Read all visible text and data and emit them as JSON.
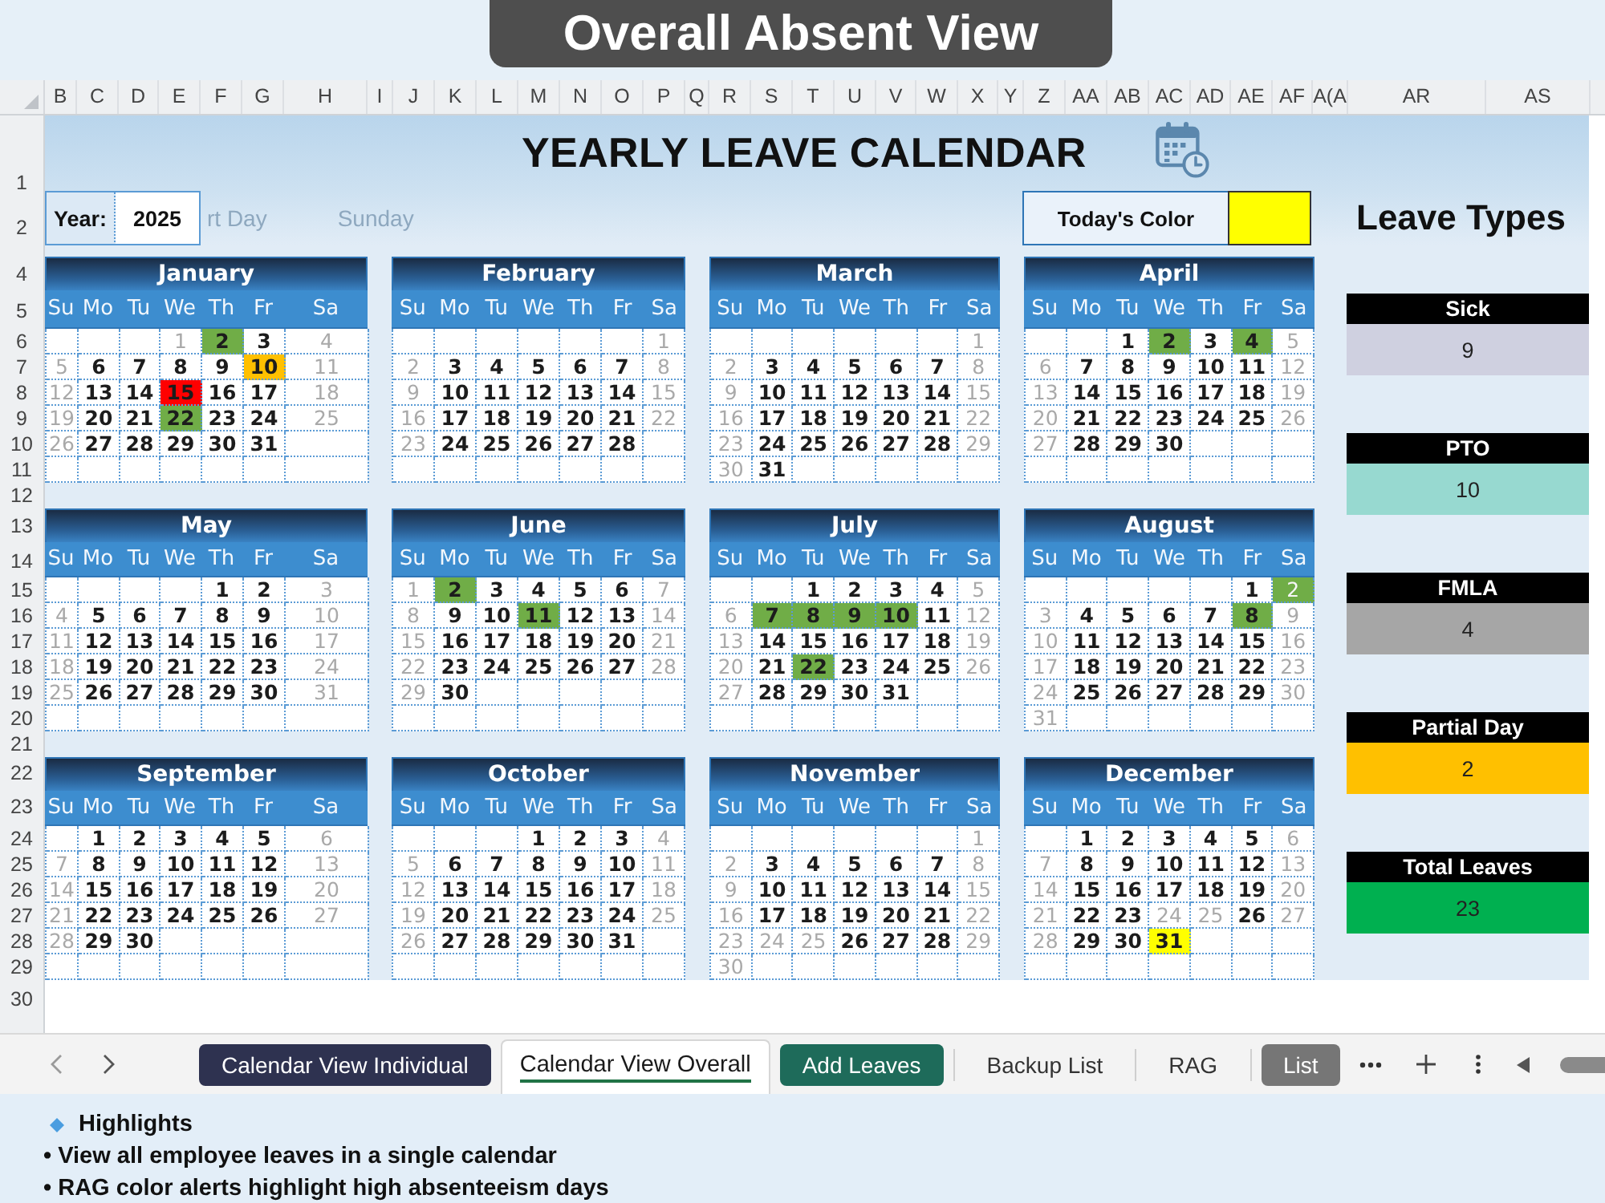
{
  "banner": "Overall Absent View",
  "column_headers": [
    "B",
    "C",
    "D",
    "E",
    "F",
    "G",
    "H",
    "I",
    "J",
    "K",
    "L",
    "M",
    "N",
    "O",
    "P",
    "Q",
    "R",
    "S",
    "T",
    "U",
    "V",
    "W",
    "X",
    "Y",
    "Z",
    "AA",
    "AB",
    "AC",
    "AD",
    "AE",
    "AF",
    "A(A",
    "AR",
    "AS"
  ],
  "row_headers": [
    "1",
    "2",
    "4",
    "5",
    "6",
    "7",
    "8",
    "9",
    "10",
    "11",
    "12",
    "13",
    "14",
    "15",
    "16",
    "17",
    "18",
    "19",
    "20",
    "21",
    "22",
    "23",
    "24",
    "25",
    "26",
    "27",
    "28",
    "29",
    "30"
  ],
  "title": "YEARLY LEAVE CALENDAR",
  "year": {
    "label": "Year:",
    "value": "2025"
  },
  "faint_labels": [
    "rt Day",
    "Sunday"
  ],
  "today": {
    "label": "Today's Color",
    "color": "#ffff00"
  },
  "months": [
    {
      "name": "January",
      "weekdays": [
        "Su",
        "Mo",
        "Tu",
        "We",
        "Th",
        "Fr",
        "Sa"
      ],
      "weeks": [
        [
          {
            "day": "1",
            "off": true
          },
          {
            "day": "2",
            "off": false,
            "color": "#70ad47"
          },
          {
            "day": "3",
            "off": false
          },
          {
            "day": "4",
            "off": true
          }
        ],
        [
          {
            "day": "5",
            "off": true
          },
          {
            "day": "6",
            "off": false
          },
          {
            "day": "7",
            "off": false
          },
          {
            "day": "8",
            "off": false
          },
          {
            "day": "9",
            "off": false
          },
          {
            "day": "10",
            "off": false,
            "color": "#ffc000"
          },
          {
            "day": "11",
            "off": true
          }
        ],
        [
          {
            "day": "12",
            "off": true
          },
          {
            "day": "13",
            "off": false
          },
          {
            "day": "14",
            "off": false
          },
          {
            "day": "15",
            "off": false,
            "color": "#ff0000"
          },
          {
            "day": "16",
            "off": false
          },
          {
            "day": "17",
            "off": false
          },
          {
            "day": "18",
            "off": true
          }
        ],
        [
          {
            "day": "19",
            "off": true
          },
          {
            "day": "20",
            "off": false
          },
          {
            "day": "21",
            "off": false
          },
          {
            "day": "22",
            "off": false,
            "color": "#70ad47"
          },
          {
            "day": "23",
            "off": false
          },
          {
            "day": "24",
            "off": false
          },
          {
            "day": "25",
            "off": true
          }
        ],
        [
          {
            "day": "26",
            "off": true
          },
          {
            "day": "27",
            "off": false
          },
          {
            "day": "28",
            "off": false
          },
          {
            "day": "29",
            "off": false
          },
          {
            "day": "30",
            "off": false
          },
          {
            "day": "31",
            "off": false
          }
        ]
      ]
    },
    {
      "name": "February",
      "weekdays": [
        "Su",
        "Mo",
        "Tu",
        "We",
        "Th",
        "Fr",
        "Sa"
      ],
      "weeks": [
        [
          {
            "day": "1",
            "off": true
          }
        ],
        [
          {
            "day": "2",
            "off": true
          },
          {
            "day": "3",
            "off": false
          },
          {
            "day": "4",
            "off": false
          },
          {
            "day": "5",
            "off": false
          },
          {
            "day": "6",
            "off": false
          },
          {
            "day": "7",
            "off": false
          },
          {
            "day": "8",
            "off": true
          }
        ],
        [
          {
            "day": "9",
            "off": true
          },
          {
            "day": "10",
            "off": false
          },
          {
            "day": "11",
            "off": false
          },
          {
            "day": "12",
            "off": false
          },
          {
            "day": "13",
            "off": false
          },
          {
            "day": "14",
            "off": false
          },
          {
            "day": "15",
            "off": true
          }
        ],
        [
          {
            "day": "16",
            "off": true
          },
          {
            "day": "17",
            "off": false
          },
          {
            "day": "18",
            "off": false
          },
          {
            "day": "19",
            "off": false
          },
          {
            "day": "20",
            "off": false
          },
          {
            "day": "21",
            "off": false
          },
          {
            "day": "22",
            "off": true
          }
        ],
        [
          {
            "day": "23",
            "off": true
          },
          {
            "day": "24",
            "off": false
          },
          {
            "day": "25",
            "off": false
          },
          {
            "day": "26",
            "off": false
          },
          {
            "day": "27",
            "off": false
          },
          {
            "day": "28",
            "off": false
          }
        ]
      ]
    },
    {
      "name": "March",
      "weekdays": [
        "Su",
        "Mo",
        "Tu",
        "We",
        "Th",
        "Fr",
        "Sa"
      ],
      "weeks": [
        [
          {
            "day": "1",
            "off": true
          }
        ],
        [
          {
            "day": "2",
            "off": true
          },
          {
            "day": "3",
            "off": false
          },
          {
            "day": "4",
            "off": false
          },
          {
            "day": "5",
            "off": false
          },
          {
            "day": "6",
            "off": false
          },
          {
            "day": "7",
            "off": false
          },
          {
            "day": "8",
            "off": true
          }
        ],
        [
          {
            "day": "9",
            "off": true
          },
          {
            "day": "10",
            "off": false
          },
          {
            "day": "11",
            "off": false
          },
          {
            "day": "12",
            "off": false
          },
          {
            "day": "13",
            "off": false
          },
          {
            "day": "14",
            "off": false
          },
          {
            "day": "15",
            "off": true
          }
        ],
        [
          {
            "day": "16",
            "off": true
          },
          {
            "day": "17",
            "off": false
          },
          {
            "day": "18",
            "off": false
          },
          {
            "day": "19",
            "off": false
          },
          {
            "day": "20",
            "off": false
          },
          {
            "day": "21",
            "off": false
          },
          {
            "day": "22",
            "off": true
          }
        ],
        [
          {
            "day": "23",
            "off": true
          },
          {
            "day": "24",
            "off": false
          },
          {
            "day": "25",
            "off": false
          },
          {
            "day": "26",
            "off": false
          },
          {
            "day": "27",
            "off": false
          },
          {
            "day": "28",
            "off": false
          },
          {
            "day": "29",
            "off": true
          }
        ],
        [
          {
            "day": "30",
            "off": true
          },
          {
            "day": "31",
            "off": false
          }
        ]
      ]
    },
    {
      "name": "April",
      "weekdays": [
        "Su",
        "Mo",
        "Tu",
        "We",
        "Th",
        "Fr",
        "Sa"
      ],
      "weeks": [
        [
          {
            "day": "1",
            "off": false
          },
          {
            "day": "2",
            "off": false,
            "color": "#70ad47"
          },
          {
            "day": "3",
            "off": false
          },
          {
            "day": "4",
            "off": false,
            "color": "#70ad47"
          },
          {
            "day": "5",
            "off": true
          }
        ],
        [
          {
            "day": "6",
            "off": true
          },
          {
            "day": "7",
            "off": false
          },
          {
            "day": "8",
            "off": false
          },
          {
            "day": "9",
            "off": false
          },
          {
            "day": "10",
            "off": false
          },
          {
            "day": "11",
            "off": false
          },
          {
            "day": "12",
            "off": true
          }
        ],
        [
          {
            "day": "13",
            "off": true
          },
          {
            "day": "14",
            "off": false
          },
          {
            "day": "15",
            "off": false
          },
          {
            "day": "16",
            "off": false
          },
          {
            "day": "17",
            "off": false
          },
          {
            "day": "18",
            "off": false
          },
          {
            "day": "19",
            "off": true
          }
        ],
        [
          {
            "day": "20",
            "off": true
          },
          {
            "day": "21",
            "off": false
          },
          {
            "day": "22",
            "off": false
          },
          {
            "day": "23",
            "off": false
          },
          {
            "day": "24",
            "off": false
          },
          {
            "day": "25",
            "off": false
          },
          {
            "day": "26",
            "off": true
          }
        ],
        [
          {
            "day": "27",
            "off": true
          },
          {
            "day": "28",
            "off": false
          },
          {
            "day": "29",
            "off": false
          },
          {
            "day": "30",
            "off": false
          }
        ]
      ]
    },
    {
      "name": "May",
      "weekdays": [
        "Su",
        "Mo",
        "Tu",
        "We",
        "Th",
        "Fr",
        "Sa"
      ],
      "weeks": [
        [
          {
            "day": "1",
            "off": false
          },
          {
            "day": "2",
            "off": false
          },
          {
            "day": "3",
            "off": true
          }
        ],
        [
          {
            "day": "4",
            "off": true
          },
          {
            "day": "5",
            "off": false
          },
          {
            "day": "6",
            "off": false
          },
          {
            "day": "7",
            "off": false
          },
          {
            "day": "8",
            "off": false
          },
          {
            "day": "9",
            "off": false
          },
          {
            "day": "10",
            "off": true
          }
        ],
        [
          {
            "day": "11",
            "off": true
          },
          {
            "day": "12",
            "off": false
          },
          {
            "day": "13",
            "off": false
          },
          {
            "day": "14",
            "off": false
          },
          {
            "day": "15",
            "off": false
          },
          {
            "day": "16",
            "off": false
          },
          {
            "day": "17",
            "off": true
          }
        ],
        [
          {
            "day": "18",
            "off": true
          },
          {
            "day": "19",
            "off": false
          },
          {
            "day": "20",
            "off": false
          },
          {
            "day": "21",
            "off": false
          },
          {
            "day": "22",
            "off": false
          },
          {
            "day": "23",
            "off": false
          },
          {
            "day": "24",
            "off": true
          }
        ],
        [
          {
            "day": "25",
            "off": true
          },
          {
            "day": "26",
            "off": false
          },
          {
            "day": "27",
            "off": false
          },
          {
            "day": "28",
            "off": false
          },
          {
            "day": "29",
            "off": false
          },
          {
            "day": "30",
            "off": false
          },
          {
            "day": "31",
            "off": true
          }
        ]
      ]
    },
    {
      "name": "June",
      "weekdays": [
        "Su",
        "Mo",
        "Tu",
        "We",
        "Th",
        "Fr",
        "Sa"
      ],
      "weeks": [
        [
          {
            "day": "1",
            "off": true
          },
          {
            "day": "2",
            "off": false,
            "color": "#70ad47"
          },
          {
            "day": "3",
            "off": false
          },
          {
            "day": "4",
            "off": false
          },
          {
            "day": "5",
            "off": false
          },
          {
            "day": "6",
            "off": false
          },
          {
            "day": "7",
            "off": true
          }
        ],
        [
          {
            "day": "8",
            "off": true
          },
          {
            "day": "9",
            "off": false
          },
          {
            "day": "10",
            "off": false
          },
          {
            "day": "11",
            "off": false,
            "color": "#70ad47"
          },
          {
            "day": "12",
            "off": false
          },
          {
            "day": "13",
            "off": false
          },
          {
            "day": "14",
            "off": true
          }
        ],
        [
          {
            "day": "15",
            "off": true
          },
          {
            "day": "16",
            "off": false
          },
          {
            "day": "17",
            "off": false
          },
          {
            "day": "18",
            "off": false
          },
          {
            "day": "19",
            "off": false
          },
          {
            "day": "20",
            "off": false
          },
          {
            "day": "21",
            "off": true
          }
        ],
        [
          {
            "day": "22",
            "off": true
          },
          {
            "day": "23",
            "off": false
          },
          {
            "day": "24",
            "off": false
          },
          {
            "day": "25",
            "off": false
          },
          {
            "day": "26",
            "off": false
          },
          {
            "day": "27",
            "off": false
          },
          {
            "day": "28",
            "off": true
          }
        ],
        [
          {
            "day": "29",
            "off": true
          },
          {
            "day": "30",
            "off": false
          }
        ]
      ]
    },
    {
      "name": "July",
      "weekdays": [
        "Su",
        "Mo",
        "Tu",
        "We",
        "Th",
        "Fr",
        "Sa"
      ],
      "weeks": [
        [
          {
            "day": "1",
            "off": false
          },
          {
            "day": "2",
            "off": false
          },
          {
            "day": "3",
            "off": false
          },
          {
            "day": "4",
            "off": false
          },
          {
            "day": "5",
            "off": true
          }
        ],
        [
          {
            "day": "6",
            "off": true
          },
          {
            "day": "7",
            "off": false,
            "color": "#70ad47"
          },
          {
            "day": "8",
            "off": false,
            "color": "#70ad47"
          },
          {
            "day": "9",
            "off": false,
            "color": "#70ad47"
          },
          {
            "day": "10",
            "off": false,
            "color": "#70ad47"
          },
          {
            "day": "11",
            "off": false
          },
          {
            "day": "12",
            "off": true
          }
        ],
        [
          {
            "day": "13",
            "off": true
          },
          {
            "day": "14",
            "off": false
          },
          {
            "day": "15",
            "off": false
          },
          {
            "day": "16",
            "off": false
          },
          {
            "day": "17",
            "off": false
          },
          {
            "day": "18",
            "off": false
          },
          {
            "day": "19",
            "off": true
          }
        ],
        [
          {
            "day": "20",
            "off": true
          },
          {
            "day": "21",
            "off": false
          },
          {
            "day": "22",
            "off": false,
            "color": "#70ad47"
          },
          {
            "day": "23",
            "off": false
          },
          {
            "day": "24",
            "off": false
          },
          {
            "day": "25",
            "off": false
          },
          {
            "day": "26",
            "off": true
          }
        ],
        [
          {
            "day": "27",
            "off": true
          },
          {
            "day": "28",
            "off": false
          },
          {
            "day": "29",
            "off": false
          },
          {
            "day": "30",
            "off": false
          },
          {
            "day": "31",
            "off": false
          }
        ]
      ]
    },
    {
      "name": "August",
      "weekdays": [
        "Su",
        "Mo",
        "Tu",
        "We",
        "Th",
        "Fr",
        "Sa"
      ],
      "weeks": [
        [
          {
            "day": "1",
            "off": false
          },
          {
            "day": "2",
            "off": true,
            "color": "#70ad47"
          }
        ],
        [
          {
            "day": "3",
            "off": true
          },
          {
            "day": "4",
            "off": false
          },
          {
            "day": "5",
            "off": false
          },
          {
            "day": "6",
            "off": false
          },
          {
            "day": "7",
            "off": false
          },
          {
            "day": "8",
            "off": false,
            "color": "#70ad47"
          },
          {
            "day": "9",
            "off": true
          }
        ],
        [
          {
            "day": "10",
            "off": true
          },
          {
            "day": "11",
            "off": false
          },
          {
            "day": "12",
            "off": false
          },
          {
            "day": "13",
            "off": false
          },
          {
            "day": "14",
            "off": false
          },
          {
            "day": "15",
            "off": false
          },
          {
            "day": "16",
            "off": true
          }
        ],
        [
          {
            "day": "17",
            "off": true
          },
          {
            "day": "18",
            "off": false
          },
          {
            "day": "19",
            "off": false
          },
          {
            "day": "20",
            "off": false
          },
          {
            "day": "21",
            "off": false
          },
          {
            "day": "22",
            "off": false
          },
          {
            "day": "23",
            "off": true
          }
        ],
        [
          {
            "day": "24",
            "off": true
          },
          {
            "day": "25",
            "off": false
          },
          {
            "day": "26",
            "off": false
          },
          {
            "day": "27",
            "off": false
          },
          {
            "day": "28",
            "off": false
          },
          {
            "day": "29",
            "off": false
          },
          {
            "day": "30",
            "off": true
          }
        ],
        [
          {
            "day": "31",
            "off": true
          }
        ]
      ]
    },
    {
      "name": "September",
      "weekdays": [
        "Su",
        "Mo",
        "Tu",
        "We",
        "Th",
        "Fr",
        "Sa"
      ],
      "weeks": [
        [
          {
            "day": "1",
            "off": false
          },
          {
            "day": "2",
            "off": false
          },
          {
            "day": "3",
            "off": false
          },
          {
            "day": "4",
            "off": false
          },
          {
            "day": "5",
            "off": false
          },
          {
            "day": "6",
            "off": true
          }
        ],
        [
          {
            "day": "7",
            "off": true
          },
          {
            "day": "8",
            "off": false
          },
          {
            "day": "9",
            "off": false
          },
          {
            "day": "10",
            "off": false
          },
          {
            "day": "11",
            "off": false
          },
          {
            "day": "12",
            "off": false
          },
          {
            "day": "13",
            "off": true
          }
        ],
        [
          {
            "day": "14",
            "off": true
          },
          {
            "day": "15",
            "off": false
          },
          {
            "day": "16",
            "off": false
          },
          {
            "day": "17",
            "off": false
          },
          {
            "day": "18",
            "off": false
          },
          {
            "day": "19",
            "off": false
          },
          {
            "day": "20",
            "off": true
          }
        ],
        [
          {
            "day": "21",
            "off": true
          },
          {
            "day": "22",
            "off": false
          },
          {
            "day": "23",
            "off": false
          },
          {
            "day": "24",
            "off": false
          },
          {
            "day": "25",
            "off": false
          },
          {
            "day": "26",
            "off": false
          },
          {
            "day": "27",
            "off": true
          }
        ],
        [
          {
            "day": "28",
            "off": true
          },
          {
            "day": "29",
            "off": false
          },
          {
            "day": "30",
            "off": false
          }
        ]
      ]
    },
    {
      "name": "October",
      "weekdays": [
        "Su",
        "Mo",
        "Tu",
        "We",
        "Th",
        "Fr",
        "Sa"
      ],
      "weeks": [
        [
          {
            "day": "1",
            "off": false
          },
          {
            "day": "2",
            "off": false
          },
          {
            "day": "3",
            "off": false
          },
          {
            "day": "4",
            "off": true
          }
        ],
        [
          {
            "day": "5",
            "off": true
          },
          {
            "day": "6",
            "off": false
          },
          {
            "day": "7",
            "off": false
          },
          {
            "day": "8",
            "off": false
          },
          {
            "day": "9",
            "off": false
          },
          {
            "day": "10",
            "off": false
          },
          {
            "day": "11",
            "off": true
          }
        ],
        [
          {
            "day": "12",
            "off": true
          },
          {
            "day": "13",
            "off": false
          },
          {
            "day": "14",
            "off": false
          },
          {
            "day": "15",
            "off": false
          },
          {
            "day": "16",
            "off": false
          },
          {
            "day": "17",
            "off": false
          },
          {
            "day": "18",
            "off": true
          }
        ],
        [
          {
            "day": "19",
            "off": true
          },
          {
            "day": "20",
            "off": false
          },
          {
            "day": "21",
            "off": false
          },
          {
            "day": "22",
            "off": false
          },
          {
            "day": "23",
            "off": false
          },
          {
            "day": "24",
            "off": false
          },
          {
            "day": "25",
            "off": true
          }
        ],
        [
          {
            "day": "26",
            "off": true
          },
          {
            "day": "27",
            "off": false
          },
          {
            "day": "28",
            "off": false
          },
          {
            "day": "29",
            "off": false
          },
          {
            "day": "30",
            "off": false
          },
          {
            "day": "31",
            "off": false
          }
        ]
      ]
    },
    {
      "name": "November",
      "weekdays": [
        "Su",
        "Mo",
        "Tu",
        "We",
        "Th",
        "Fr",
        "Sa"
      ],
      "weeks": [
        [
          {
            "day": "1",
            "off": true
          }
        ],
        [
          {
            "day": "2",
            "off": true
          },
          {
            "day": "3",
            "off": false
          },
          {
            "day": "4",
            "off": false
          },
          {
            "day": "5",
            "off": false
          },
          {
            "day": "6",
            "off": false
          },
          {
            "day": "7",
            "off": false
          },
          {
            "day": "8",
            "off": true
          }
        ],
        [
          {
            "day": "9",
            "off": true
          },
          {
            "day": "10",
            "off": false
          },
          {
            "day": "11",
            "off": false
          },
          {
            "day": "12",
            "off": false
          },
          {
            "day": "13",
            "off": false
          },
          {
            "day": "14",
            "off": false
          },
          {
            "day": "15",
            "off": true
          }
        ],
        [
          {
            "day": "16",
            "off": true
          },
          {
            "day": "17",
            "off": false
          },
          {
            "day": "18",
            "off": false
          },
          {
            "day": "19",
            "off": false
          },
          {
            "day": "20",
            "off": false
          },
          {
            "day": "21",
            "off": false
          },
          {
            "day": "22",
            "off": true
          }
        ],
        [
          {
            "day": "23",
            "off": true
          },
          {
            "day": "24",
            "off": true
          },
          {
            "day": "25",
            "off": true
          },
          {
            "day": "26",
            "off": false
          },
          {
            "day": "27",
            "off": false
          },
          {
            "day": "28",
            "off": false
          },
          {
            "day": "29",
            "off": true
          }
        ],
        [
          {
            "day": "30",
            "off": true
          }
        ]
      ]
    },
    {
      "name": "December",
      "weekdays": [
        "Su",
        "Mo",
        "Tu",
        "We",
        "Th",
        "Fr",
        "Sa"
      ],
      "weeks": [
        [
          {
            "day": "1",
            "off": false
          },
          {
            "day": "2",
            "off": false
          },
          {
            "day": "3",
            "off": false
          },
          {
            "day": "4",
            "off": false
          },
          {
            "day": "5",
            "off": false
          },
          {
            "day": "6",
            "off": true
          }
        ],
        [
          {
            "day": "7",
            "off": true
          },
          {
            "day": "8",
            "off": false
          },
          {
            "day": "9",
            "off": false
          },
          {
            "day": "10",
            "off": false
          },
          {
            "day": "11",
            "off": false
          },
          {
            "day": "12",
            "off": false
          },
          {
            "day": "13",
            "off": true
          }
        ],
        [
          {
            "day": "14",
            "off": true
          },
          {
            "day": "15",
            "off": false
          },
          {
            "day": "16",
            "off": false
          },
          {
            "day": "17",
            "off": false
          },
          {
            "day": "18",
            "off": false
          },
          {
            "day": "19",
            "off": false
          },
          {
            "day": "20",
            "off": true
          }
        ],
        [
          {
            "day": "21",
            "off": true
          },
          {
            "day": "22",
            "off": false
          },
          {
            "day": "23",
            "off": false
          },
          {
            "day": "24",
            "off": true
          },
          {
            "day": "25",
            "off": true
          },
          {
            "day": "26",
            "off": false
          },
          {
            "day": "27",
            "off": true
          }
        ],
        [
          {
            "day": "28",
            "off": true
          },
          {
            "day": "29",
            "off": false
          },
          {
            "day": "30",
            "off": false
          },
          {
            "day": "31",
            "off": false,
            "color": "#ffff00"
          }
        ]
      ]
    }
  ],
  "leave_types": {
    "title": "Leave Types",
    "items": [
      {
        "label": "Sick",
        "value": "9",
        "color": "#cfd0e0"
      },
      {
        "label": "PTO",
        "value": "10",
        "color": "#97d9d0"
      },
      {
        "label": "FMLA",
        "value": "4",
        "color": "#a6a6a6"
      },
      {
        "label": "Partial Day",
        "value": "2",
        "color": "#ffc000"
      },
      {
        "label": "Total Leaves",
        "value": "23",
        "color": "#00b050"
      }
    ]
  },
  "sheet_tabs": [
    {
      "label": "Calendar View Individual",
      "selected": false,
      "color": "#2e3250"
    },
    {
      "label": "Calendar View Overall",
      "selected": true
    },
    {
      "label": "Add Leaves",
      "selected": false,
      "color": "#1e6b5a"
    },
    {
      "label": "Backup List",
      "selected": false
    },
    {
      "label": "RAG",
      "selected": false
    },
    {
      "label": "List",
      "selected": false,
      "color": "#767676"
    }
  ],
  "highlights": {
    "title": "Highlights",
    "lines": [
      "• View all employee leaves in a single calendar",
      "• RAG color alerts highlight high absenteeism days"
    ]
  }
}
